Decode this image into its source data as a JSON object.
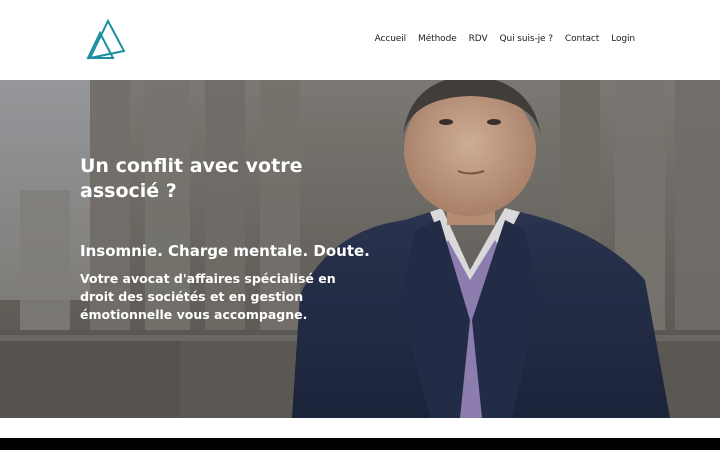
{
  "header": {
    "logo_icon": "triangle-logo",
    "accent_color": "#1d8fa0",
    "nav": [
      "Accueil",
      "Méthode",
      "RDV",
      "Qui suis-je ?",
      "Contact",
      "Login"
    ]
  },
  "hero": {
    "headline": "Un conflit avec votre associé ?",
    "tagline": "Insomnie. Charge mentale. Doute.",
    "description": "Votre avocat d'affaires spécialisé en droit des sociétés et en gestion émotionnelle vous accompagne."
  }
}
